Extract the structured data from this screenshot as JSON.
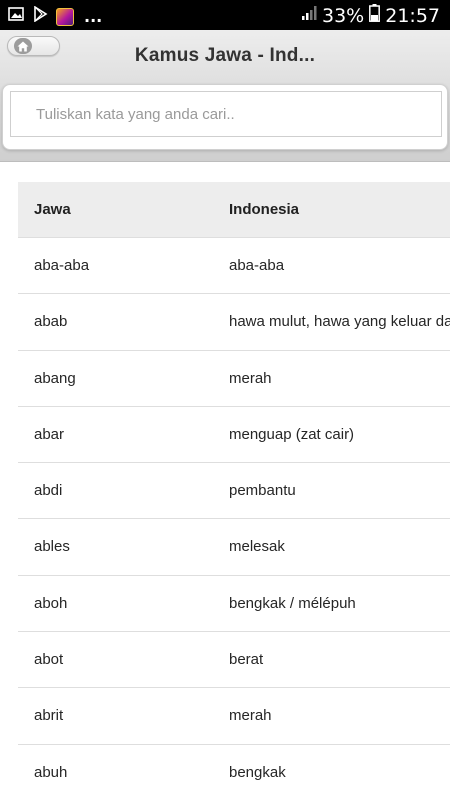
{
  "status_bar": {
    "left_icons": [
      "image-icon",
      "play-store-icon",
      "app-thumbnail-icon"
    ],
    "overflow_dots": "...",
    "signal_icon": "signal-icon",
    "battery_percent": "33%",
    "battery_icon": "battery-icon",
    "time": "21:57"
  },
  "header": {
    "home_icon": "home-icon",
    "title": "Kamus Jawa - Ind..."
  },
  "search": {
    "placeholder": "Tuliskan kata yang anda cari..",
    "value": ""
  },
  "table": {
    "columns": [
      "Jawa",
      "Indonesia"
    ],
    "rows": [
      {
        "jawa": "aba-aba",
        "indonesia": "aba-aba"
      },
      {
        "jawa": "abab",
        "indonesia": "hawa mulut, hawa yang keluar dari mulut"
      },
      {
        "jawa": "abang",
        "indonesia": "merah"
      },
      {
        "jawa": "abar",
        "indonesia": "menguap (zat cair)"
      },
      {
        "jawa": "abdi",
        "indonesia": "pembantu"
      },
      {
        "jawa": "ables",
        "indonesia": "melesak"
      },
      {
        "jawa": "aboh",
        "indonesia": "bengkak / mélépuh"
      },
      {
        "jawa": "abot",
        "indonesia": "berat"
      },
      {
        "jawa": "abrit",
        "indonesia": "merah"
      },
      {
        "jawa": "abuh",
        "indonesia": "bengkak"
      }
    ]
  }
}
